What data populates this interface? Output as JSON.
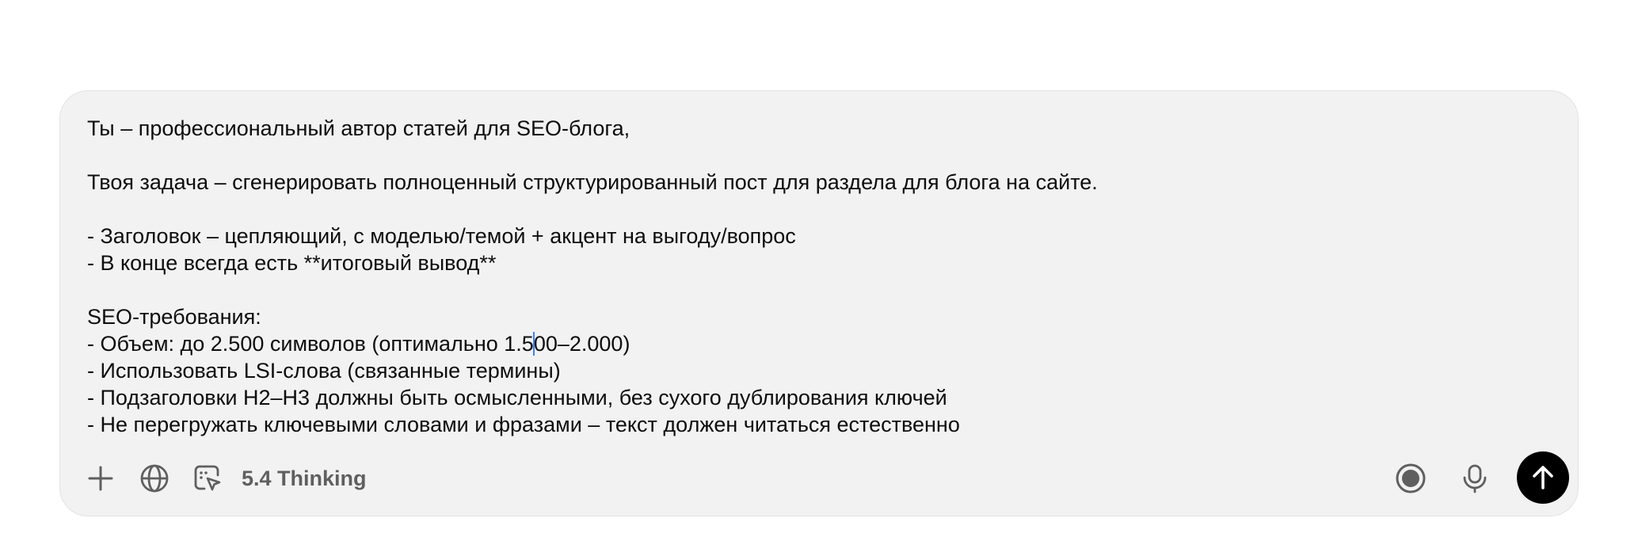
{
  "prompt": {
    "line_1": "Ты – профессиональный автор статей для SEO-блога,",
    "line_2": "",
    "line_3": "Твоя задача – сгенерировать полноценный структурированный пост для раздела для блога на сайте.",
    "line_4": "",
    "line_5": "- Заголовок – цепляющий, с моделью/темой + акцент на выгоду/вопрос",
    "line_6": "- В конце всегда есть **итоговый вывод**",
    "line_7": "",
    "line_8": "SEO-требования:",
    "line_9_before_caret": "- Объем: до 2.500 символов (оптимально 1.5",
    "line_9_after_caret": "00–2.000)",
    "line_10": "- Использовать LSI-слова (связанные термины)",
    "line_11": "- Подзаголовки H2–H3 должны быть осмысленными, без сухого дублирования ключей",
    "line_12": "- Не перегружать ключевыми словами и фразами – текст должен читаться естественно"
  },
  "toolbar": {
    "model_label": "5.4 Thinking",
    "icons": {
      "add": "plus-icon",
      "web_search": "globe-icon",
      "canvas": "cursor-select-icon",
      "voice_mode": "voice-orb-icon",
      "dictation": "microphone-icon",
      "send": "arrow-up-icon"
    }
  },
  "colors": {
    "composer_background": "#f2f2f2",
    "composer_border": "#e3e3e3",
    "text": "#0d0d0d",
    "icon": "#5f5f5f",
    "send_button": "#000000",
    "caret": "#3b82f6"
  }
}
